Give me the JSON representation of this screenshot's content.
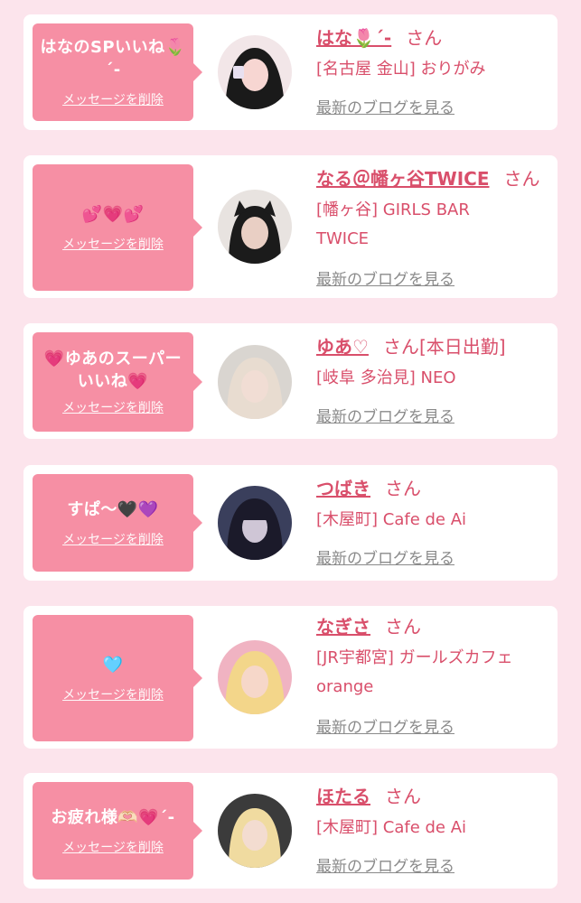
{
  "cards": [
    {
      "message": "はなのSPいいね🌷ˊ-",
      "delete_label": "メッセージを削除",
      "name": "はな🌷ˊ-",
      "honorific": "さん",
      "extra": "",
      "shop": "[名古屋 金山] おりがみ",
      "blog_label": "最新のブログを見る",
      "avatar_icon": "avatar-photo-icon",
      "avatar_colors": [
        "#f2e6e8",
        "#1a1a1a",
        "#f7d6d2"
      ]
    },
    {
      "message": "💕💗💕",
      "delete_label": "メッセージを削除",
      "name": "なる＠幡ヶ谷TWICE",
      "honorific": "さん",
      "extra": "",
      "shop": "[幡ヶ谷] GIRLS BAR TWICE",
      "blog_label": "最新のブログを見る",
      "avatar_icon": "avatar-photo-icon",
      "avatar_colors": [
        "#e8e3e0",
        "#1b1b1b",
        "#e9cfc4"
      ]
    },
    {
      "message": "💗ゆあのスーパーいいね💗",
      "delete_label": "メッセージを削除",
      "name": "ゆあ♡",
      "honorific": "さん",
      "extra": "[本日出勤]",
      "shop": "[岐阜 多治見] NEO",
      "blog_label": "最新のブログを見る",
      "avatar_icon": "avatar-photo-icon",
      "avatar_colors": [
        "#d9d5d0",
        "#e8dcd0",
        "#f1ddd4"
      ]
    },
    {
      "message": "すぱ〜🖤💜",
      "delete_label": "メッセージを削除",
      "name": "つばき",
      "honorific": "さん",
      "extra": "",
      "shop": "[木屋町] Cafe de Ai",
      "blog_label": "最新のブログを見る",
      "avatar_icon": "avatar-photo-icon",
      "avatar_colors": [
        "#3a3f5c",
        "#1b1a2a",
        "#cfc6d6"
      ]
    },
    {
      "message": "🩵",
      "delete_label": "メッセージを削除",
      "name": "なぎさ",
      "honorific": "さん",
      "extra": "",
      "shop": "[JR宇都宮] ガールズカフェ orange",
      "blog_label": "最新のブログを見る",
      "avatar_icon": "avatar-photo-icon",
      "avatar_colors": [
        "#f0b3c2",
        "#f3d68a",
        "#f6d7c9"
      ]
    },
    {
      "message": "お疲れ様🫶🏻💗ˊ-",
      "delete_label": "メッセージを削除",
      "name": "ほたる",
      "honorific": "さん",
      "extra": "",
      "shop": "[木屋町] Cafe de Ai",
      "blog_label": "最新のブログを見る",
      "avatar_icon": "avatar-photo-icon",
      "avatar_colors": [
        "#3b3b3b",
        "#f0dba0",
        "#f3dcd0"
      ]
    }
  ]
}
